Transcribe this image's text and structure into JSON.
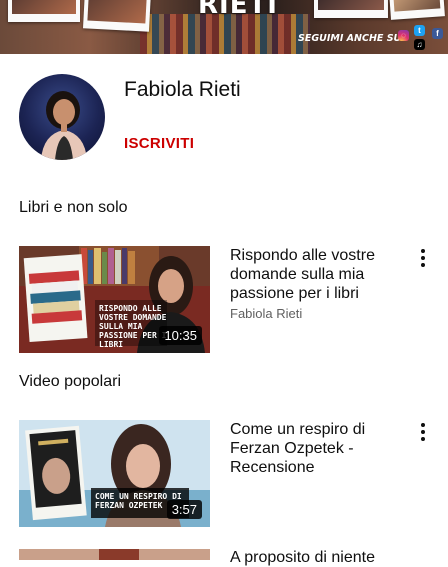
{
  "banner": {
    "title": "RIETI",
    "follow_label": "SEGUIMI ANCHE SU",
    "social_icons": [
      "instagram-icon",
      "twitter-icon",
      "facebook-icon",
      "tiktok-icon"
    ]
  },
  "channel": {
    "name": "Fabiola Rieti",
    "subscribe_label": "ISCRIVITI",
    "accent_color": "#cc0000"
  },
  "sections": [
    {
      "title": "Libri e non solo",
      "videos": [
        {
          "title": "Rispondo alle vostre domande sulla mia passione per i libri",
          "channel": "Fabiola Rieti",
          "duration": "10:35",
          "thumb_caption": "RISPONDO ALLE VOSTRE DOMANDE SULLA MIA PASSIONE PER I LIBRI"
        }
      ]
    },
    {
      "title": "Video popolari",
      "videos": [
        {
          "title": "Come un respiro di Ferzan Ozpetek - Recensione",
          "duration": "3:57",
          "thumb_caption": "COME UN RESPIRO DI FERZAN OZPETEK"
        },
        {
          "title": "A proposito di niente"
        }
      ]
    }
  ]
}
